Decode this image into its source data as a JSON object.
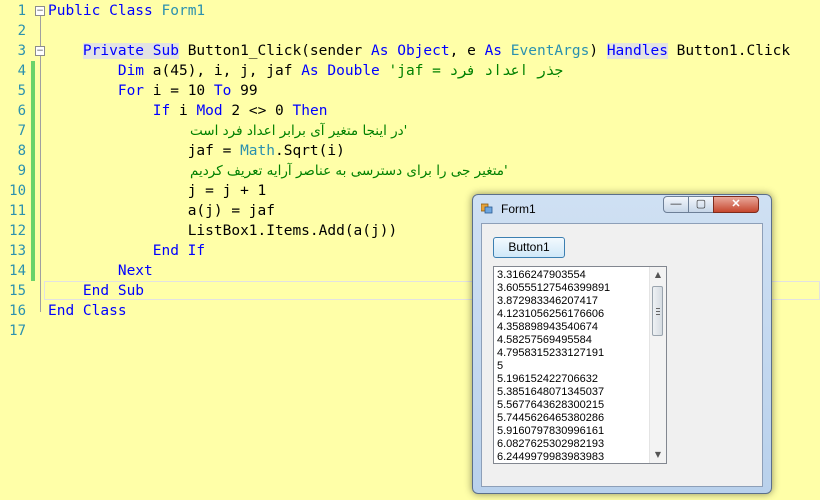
{
  "editor": {
    "line_numbers": [
      "1",
      "2",
      "3",
      "4",
      "5",
      "6",
      "7",
      "8",
      "9",
      "10",
      "11",
      "12",
      "13",
      "14",
      "15",
      "16",
      "17"
    ],
    "lines": {
      "l1": {
        "kw1": "Public Class",
        "ty1": "Form1"
      },
      "l3": {
        "kw1": "Private Sub",
        "t1": "Button1_Click(sender",
        "kw2": "As",
        "ty1": "Object",
        "t2": ", e",
        "kw3": "As",
        "ty2": "EventArgs",
        "t3": ")",
        "kw4": "Handles",
        "t4": "Button1.Click"
      },
      "l4": {
        "kw1": "Dim",
        "t1": "a(45), i, j, jaf",
        "kw2": "As",
        "kw3": "Double",
        "cm": "'jaf = جذر اعداد فرد"
      },
      "l5": {
        "kw1": "For",
        "t1": "i = 10",
        "kw2": "To",
        "t2": "99"
      },
      "l6": {
        "kw1": "If",
        "t1": "i",
        "kw2": "Mod",
        "t2": "2 <> 0",
        "kw3": "Then"
      },
      "l7": {
        "cm": "'در اینجا متغیر آی برابر اعداد فرد است"
      },
      "l8": {
        "t1": "jaf =",
        "ty1": "Math",
        "t2": ".Sqrt(i)"
      },
      "l9": {
        "cm": "'متغیر جی را برای دسترسی به عناصر آرایه تعریف کردیم"
      },
      "l10": {
        "t1": "j = j + 1"
      },
      "l11": {
        "t1": "a(j) = jaf"
      },
      "l12": {
        "t1": "ListBox1.Items.Add(a(j))"
      },
      "l13": {
        "kw1": "End If"
      },
      "l14": {
        "kw1": "Next"
      },
      "l15": {
        "kw1": "End Sub"
      },
      "l16": {
        "kw1": "End Class"
      }
    }
  },
  "form": {
    "title": "Form1",
    "app_icon": "winforms-app-icon",
    "minimize_glyph": "—",
    "maximize_glyph": "▢",
    "close_glyph": "✕",
    "button1_label": "Button1",
    "listbox_items": [
      "3.3166247903554",
      "3.60555127546399891",
      "3.872983346207417",
      "4.1231056256176606",
      "4.358898943540674",
      "4.58257569495584",
      "4.7958315233127191",
      "5",
      "5.196152422706632",
      "5.3851648071345037",
      "5.5677643628300215",
      "5.7445626465380286",
      "5.9160797830996161",
      "6.0827625302982193",
      "6.2449979983983983"
    ],
    "scroll_up_glyph": "▲",
    "scroll_down_glyph": "▼"
  }
}
